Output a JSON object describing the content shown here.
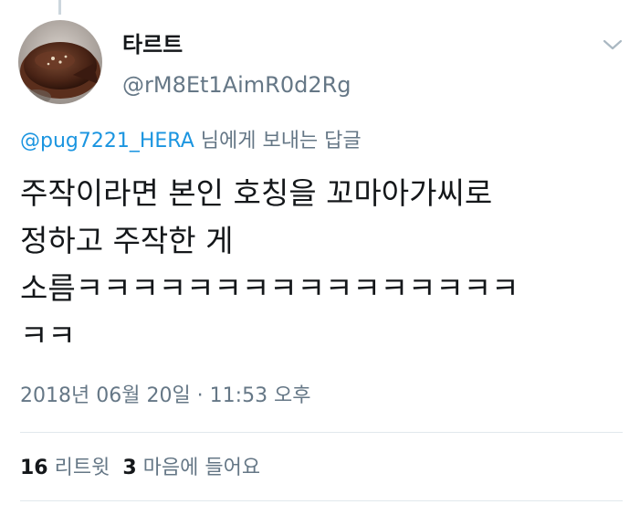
{
  "tweet": {
    "author": {
      "display_name": "타르트",
      "handle": "@rM8Et1AimR0d2Rg",
      "avatar_icon": "tart-avatar-image"
    },
    "menu_icon": "chevron-down-icon",
    "reply_to": {
      "mention": "@pug7221_HERA",
      "suffix": " 님에게 보내는 답글"
    },
    "text_lines": [
      "주작이라면 본인 호칭을 꼬마아가씨로",
      "정하고 주작한 게",
      "소름ㅋㅋㅋㅋㅋㅋㅋㅋㅋㅋㅋㅋㅋㅋㅋㅋ",
      "ㅋㅋ"
    ],
    "timestamp": "2018년 06월 20일 · 11:53 오후",
    "stats": {
      "retweets_count": "16",
      "retweets_label": "리트윗",
      "likes_count": "3",
      "likes_label": "마음에 들어요"
    }
  },
  "colors": {
    "text_primary": "#14171a",
    "text_secondary": "#657786",
    "link": "#1b95e0",
    "divider": "#e1e8ed"
  }
}
